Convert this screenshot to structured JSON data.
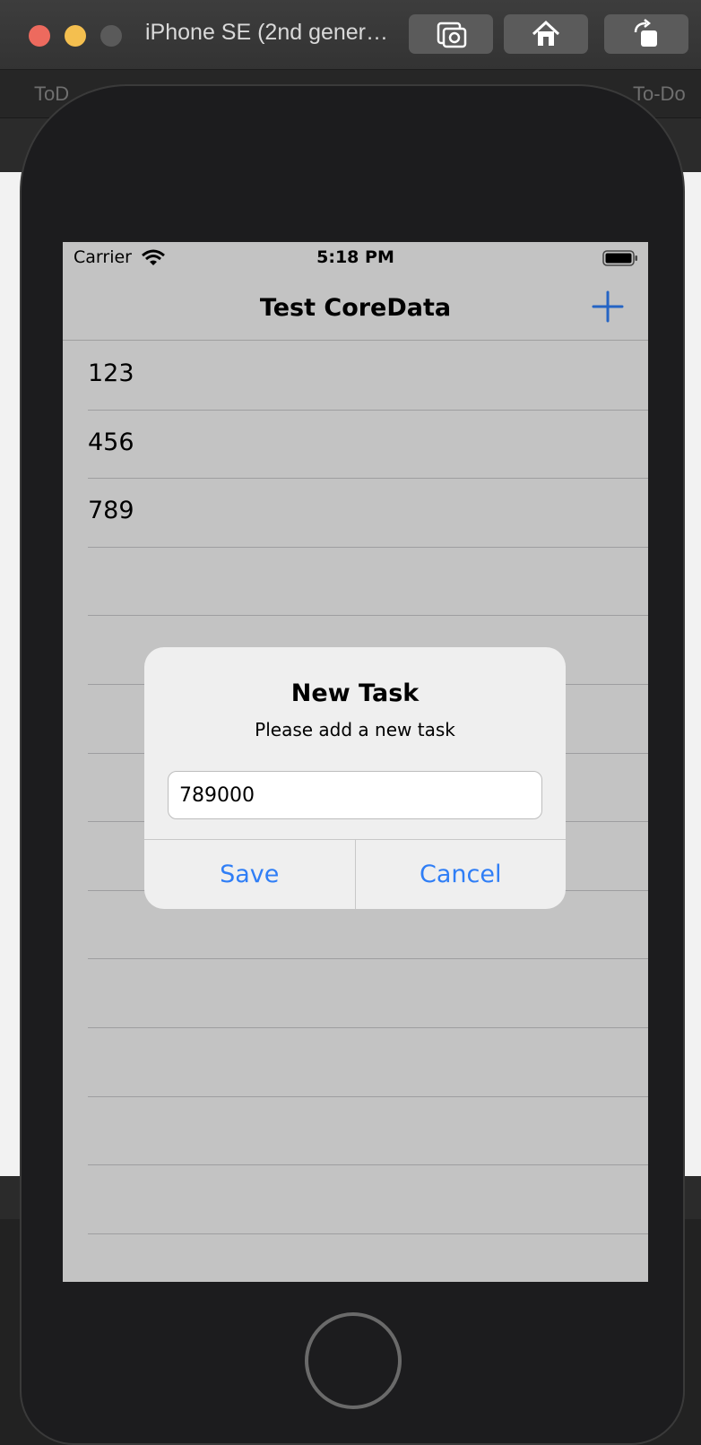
{
  "window": {
    "title": "iPhone SE (2nd gener…",
    "buttons": [
      "screenshot-icon",
      "home-icon",
      "rotate-icon"
    ]
  },
  "background": {
    "breadcrumbs": [
      "ToD",
      "To-Do"
    ]
  },
  "statusbar": {
    "carrier": "Carrier",
    "time": "5:18 PM"
  },
  "navbar": {
    "title": "Test CoreData",
    "add_icon": "plus-icon"
  },
  "tasks": [
    "123",
    "456",
    "789",
    "",
    "",
    "",
    "",
    "",
    "",
    "",
    "",
    "",
    "",
    ""
  ],
  "alert": {
    "title": "New Task",
    "message": "Please add a new task",
    "field_value": "789000",
    "save_label": "Save",
    "cancel_label": "Cancel"
  },
  "colors": {
    "accent": "#2f7ef6",
    "window_close": "#ed6a5e",
    "window_minimize": "#f4bf4f"
  }
}
